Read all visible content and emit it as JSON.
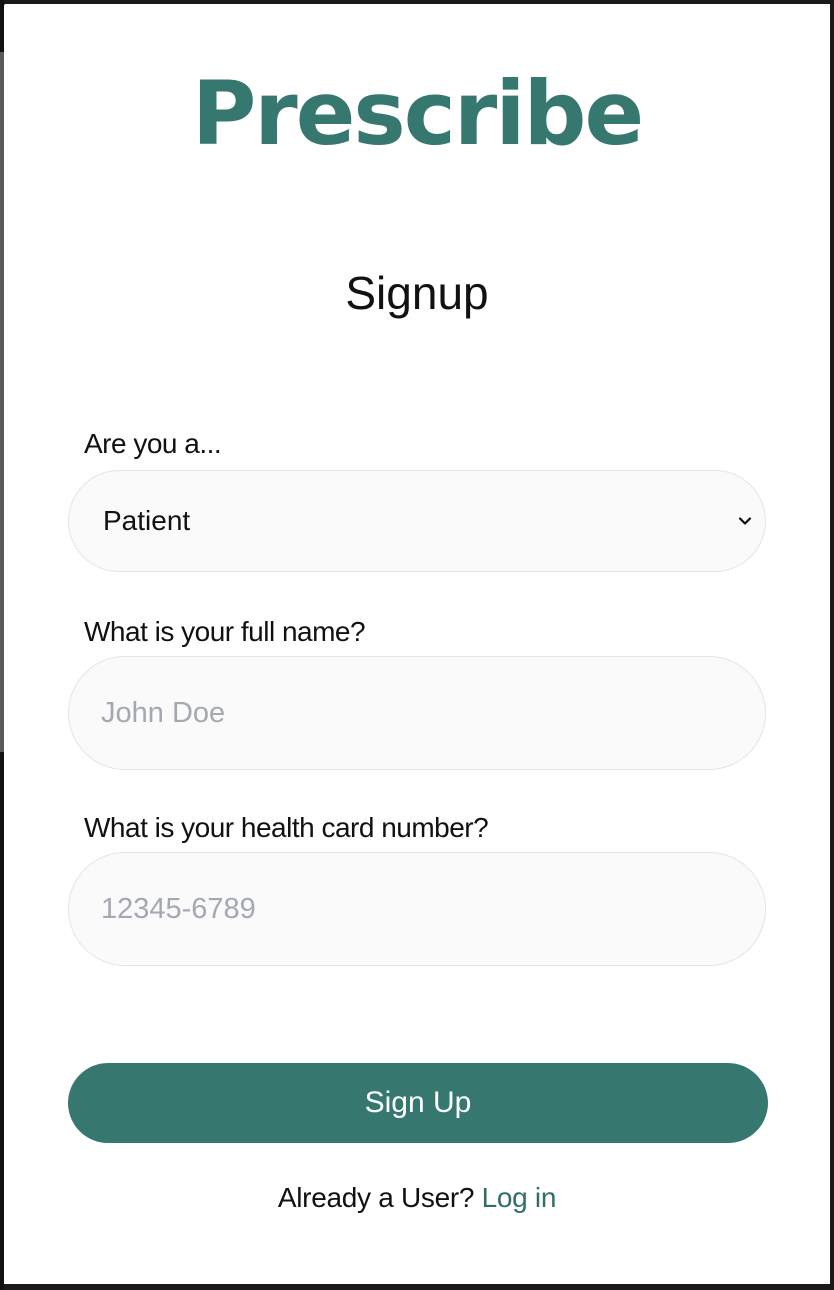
{
  "app": {
    "logo_text": "Prescribe",
    "heading": "Signup"
  },
  "form": {
    "role": {
      "label": "Are you a...",
      "selected_value": "Patient"
    },
    "full_name": {
      "label": "What is your full name?",
      "placeholder": "John Doe",
      "value": ""
    },
    "health_card": {
      "label": "What is your health card number?",
      "placeholder": "12345-6789",
      "value": ""
    },
    "submit_label": "Sign Up"
  },
  "footer": {
    "prompt_text": "Already a User?",
    "login_link_label": "Log in"
  },
  "colors": {
    "brand": "#367870",
    "link": "#2f6f68",
    "field_background": "#fafafa",
    "field_border": "#e4e4e4",
    "placeholder": "#a3a8b3"
  },
  "icons": {
    "select_indicator": "chevron-down-icon"
  }
}
